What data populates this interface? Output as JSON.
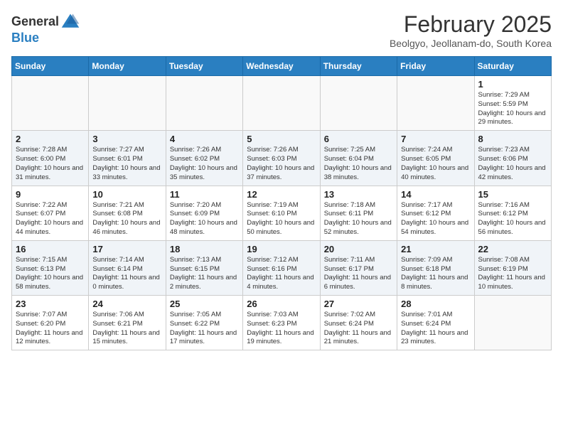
{
  "logo": {
    "text_general": "General",
    "text_blue": "Blue"
  },
  "header": {
    "month_year": "February 2025",
    "location": "Beolgyo, Jeollanam-do, South Korea"
  },
  "weekdays": [
    "Sunday",
    "Monday",
    "Tuesday",
    "Wednesday",
    "Thursday",
    "Friday",
    "Saturday"
  ],
  "weeks": [
    [
      {
        "day": "",
        "info": ""
      },
      {
        "day": "",
        "info": ""
      },
      {
        "day": "",
        "info": ""
      },
      {
        "day": "",
        "info": ""
      },
      {
        "day": "",
        "info": ""
      },
      {
        "day": "",
        "info": ""
      },
      {
        "day": "1",
        "info": "Sunrise: 7:29 AM\nSunset: 5:59 PM\nDaylight: 10 hours and 29 minutes."
      }
    ],
    [
      {
        "day": "2",
        "info": "Sunrise: 7:28 AM\nSunset: 6:00 PM\nDaylight: 10 hours and 31 minutes."
      },
      {
        "day": "3",
        "info": "Sunrise: 7:27 AM\nSunset: 6:01 PM\nDaylight: 10 hours and 33 minutes."
      },
      {
        "day": "4",
        "info": "Sunrise: 7:26 AM\nSunset: 6:02 PM\nDaylight: 10 hours and 35 minutes."
      },
      {
        "day": "5",
        "info": "Sunrise: 7:26 AM\nSunset: 6:03 PM\nDaylight: 10 hours and 37 minutes."
      },
      {
        "day": "6",
        "info": "Sunrise: 7:25 AM\nSunset: 6:04 PM\nDaylight: 10 hours and 38 minutes."
      },
      {
        "day": "7",
        "info": "Sunrise: 7:24 AM\nSunset: 6:05 PM\nDaylight: 10 hours and 40 minutes."
      },
      {
        "day": "8",
        "info": "Sunrise: 7:23 AM\nSunset: 6:06 PM\nDaylight: 10 hours and 42 minutes."
      }
    ],
    [
      {
        "day": "9",
        "info": "Sunrise: 7:22 AM\nSunset: 6:07 PM\nDaylight: 10 hours and 44 minutes."
      },
      {
        "day": "10",
        "info": "Sunrise: 7:21 AM\nSunset: 6:08 PM\nDaylight: 10 hours and 46 minutes."
      },
      {
        "day": "11",
        "info": "Sunrise: 7:20 AM\nSunset: 6:09 PM\nDaylight: 10 hours and 48 minutes."
      },
      {
        "day": "12",
        "info": "Sunrise: 7:19 AM\nSunset: 6:10 PM\nDaylight: 10 hours and 50 minutes."
      },
      {
        "day": "13",
        "info": "Sunrise: 7:18 AM\nSunset: 6:11 PM\nDaylight: 10 hours and 52 minutes."
      },
      {
        "day": "14",
        "info": "Sunrise: 7:17 AM\nSunset: 6:12 PM\nDaylight: 10 hours and 54 minutes."
      },
      {
        "day": "15",
        "info": "Sunrise: 7:16 AM\nSunset: 6:12 PM\nDaylight: 10 hours and 56 minutes."
      }
    ],
    [
      {
        "day": "16",
        "info": "Sunrise: 7:15 AM\nSunset: 6:13 PM\nDaylight: 10 hours and 58 minutes."
      },
      {
        "day": "17",
        "info": "Sunrise: 7:14 AM\nSunset: 6:14 PM\nDaylight: 11 hours and 0 minutes."
      },
      {
        "day": "18",
        "info": "Sunrise: 7:13 AM\nSunset: 6:15 PM\nDaylight: 11 hours and 2 minutes."
      },
      {
        "day": "19",
        "info": "Sunrise: 7:12 AM\nSunset: 6:16 PM\nDaylight: 11 hours and 4 minutes."
      },
      {
        "day": "20",
        "info": "Sunrise: 7:11 AM\nSunset: 6:17 PM\nDaylight: 11 hours and 6 minutes."
      },
      {
        "day": "21",
        "info": "Sunrise: 7:09 AM\nSunset: 6:18 PM\nDaylight: 11 hours and 8 minutes."
      },
      {
        "day": "22",
        "info": "Sunrise: 7:08 AM\nSunset: 6:19 PM\nDaylight: 11 hours and 10 minutes."
      }
    ],
    [
      {
        "day": "23",
        "info": "Sunrise: 7:07 AM\nSunset: 6:20 PM\nDaylight: 11 hours and 12 minutes."
      },
      {
        "day": "24",
        "info": "Sunrise: 7:06 AM\nSunset: 6:21 PM\nDaylight: 11 hours and 15 minutes."
      },
      {
        "day": "25",
        "info": "Sunrise: 7:05 AM\nSunset: 6:22 PM\nDaylight: 11 hours and 17 minutes."
      },
      {
        "day": "26",
        "info": "Sunrise: 7:03 AM\nSunset: 6:23 PM\nDaylight: 11 hours and 19 minutes."
      },
      {
        "day": "27",
        "info": "Sunrise: 7:02 AM\nSunset: 6:24 PM\nDaylight: 11 hours and 21 minutes."
      },
      {
        "day": "28",
        "info": "Sunrise: 7:01 AM\nSunset: 6:24 PM\nDaylight: 11 hours and 23 minutes."
      },
      {
        "day": "",
        "info": ""
      }
    ]
  ]
}
